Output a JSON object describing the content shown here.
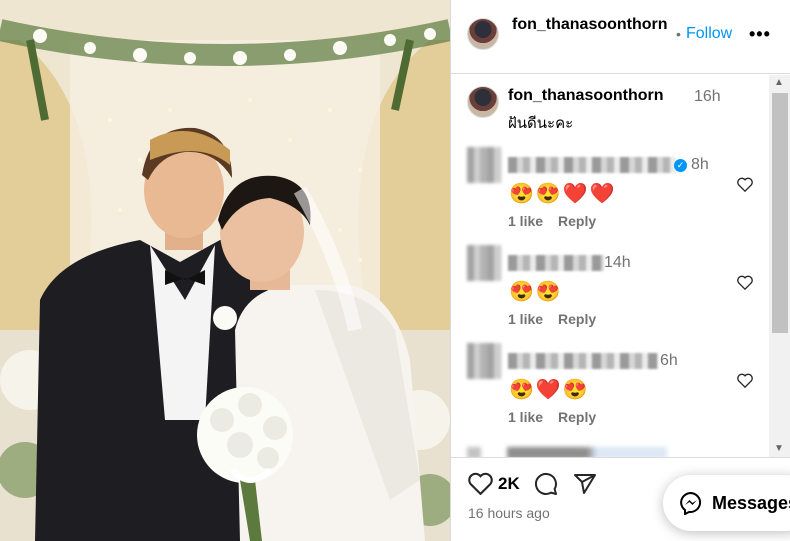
{
  "post": {
    "author": "fon_thanasoonthorn",
    "follow_label": "Follow",
    "more_label": "•••",
    "photo_icon": "wedding-photo",
    "caption": {
      "username": "fon_thanasoonthorn",
      "time": "16h",
      "text": "ฝันดีนะคะ"
    },
    "comments": [
      {
        "time": "8h",
        "emojis": "😍😍❤️❤️",
        "likes": "1 like",
        "reply": "Reply",
        "verified": true
      },
      {
        "time": "14h",
        "emojis": "😍😍",
        "likes": "1 like",
        "reply": "Reply",
        "verified": false
      },
      {
        "time": "6h",
        "emojis": "😍❤️😍",
        "likes": "1 like",
        "reply": "Reply",
        "verified": false
      }
    ],
    "like_count": "2K",
    "posted_ago": "16 hours ago"
  },
  "messages_button": {
    "label": "Messages"
  },
  "colors": {
    "accent": "#0095f6",
    "secondary_text": "#737373",
    "border": "#dbdbdb"
  },
  "icons": [
    "heart-icon",
    "comment-icon",
    "share-icon",
    "messenger-icon",
    "more-icon",
    "verified-icon"
  ]
}
